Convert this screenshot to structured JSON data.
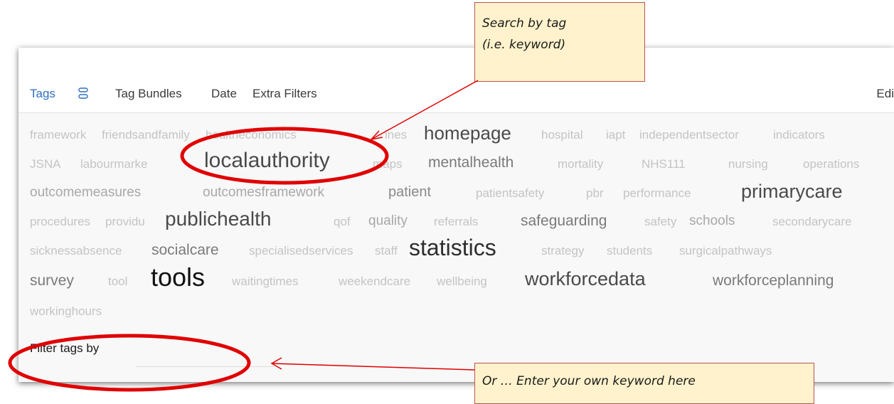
{
  "tabs": {
    "tags": "Tags",
    "tag_bundles": "Tag Bundles",
    "date": "Date",
    "extra_filters": "Extra Filters",
    "edit": "Edi"
  },
  "tag_cloud": [
    {
      "text": "framework",
      "size": "small"
    },
    {
      "text": "friendsandfamily",
      "size": "small"
    },
    {
      "text": "healtheconomics",
      "size": "small"
    },
    {
      "text": "ines",
      "size": "small"
    },
    {
      "text": "homepage",
      "size": "large"
    },
    {
      "text": "hospital",
      "size": "small"
    },
    {
      "text": "iapt",
      "size": "small"
    },
    {
      "text": "independentsector",
      "size": "small"
    },
    {
      "text": "indicators",
      "size": "small"
    },
    {
      "text": "JSNA",
      "size": "small"
    },
    {
      "text": "labourmarke",
      "size": "small"
    },
    {
      "text": "localauthority",
      "size": "xlarge"
    },
    {
      "text": "maps",
      "size": "small"
    },
    {
      "text": "mentalhealth",
      "size": "medium"
    },
    {
      "text": "mortality",
      "size": "small"
    },
    {
      "text": "NHS111",
      "size": "small"
    },
    {
      "text": "nursing",
      "size": "small"
    },
    {
      "text": "operations",
      "size": "small"
    },
    {
      "text": "outcomemeasures",
      "size": "small"
    },
    {
      "text": "outcomesframework",
      "size": "small"
    },
    {
      "text": "patient",
      "size": "small"
    },
    {
      "text": "patientsafety",
      "size": "small"
    },
    {
      "text": "pbr",
      "size": "small"
    },
    {
      "text": "performance",
      "size": "small"
    },
    {
      "text": "primarycare",
      "size": "large"
    },
    {
      "text": "procedures",
      "size": "small"
    },
    {
      "text": "providu",
      "size": "small"
    },
    {
      "text": "publichealth",
      "size": "large"
    },
    {
      "text": "qof",
      "size": "small"
    },
    {
      "text": "quality",
      "size": "small"
    },
    {
      "text": "referrals",
      "size": "small"
    },
    {
      "text": "safeguarding",
      "size": "medium"
    },
    {
      "text": "safety",
      "size": "small"
    },
    {
      "text": "schools",
      "size": "small"
    },
    {
      "text": "secondarycare",
      "size": "small"
    },
    {
      "text": "sicknessabsence",
      "size": "small"
    },
    {
      "text": "socialcare",
      "size": "medium"
    },
    {
      "text": "specialisedservices",
      "size": "small"
    },
    {
      "text": "staff",
      "size": "small"
    },
    {
      "text": "statistics",
      "size": "xlarge"
    },
    {
      "text": "strategy",
      "size": "small"
    },
    {
      "text": "students",
      "size": "small"
    },
    {
      "text": "surgicalpathways",
      "size": "small"
    },
    {
      "text": "survey",
      "size": "medium"
    },
    {
      "text": "tool",
      "size": "small"
    },
    {
      "text": "tools",
      "size": "xlarge"
    },
    {
      "text": "waitingtimes",
      "size": "small"
    },
    {
      "text": "weekendcare",
      "size": "small"
    },
    {
      "text": "wellbeing",
      "size": "small"
    },
    {
      "text": "workforcedata",
      "size": "large"
    },
    {
      "text": "workforceplanning",
      "size": "medium"
    },
    {
      "text": "workinghours",
      "size": "small"
    }
  ],
  "filter": {
    "label": "Filter tags by",
    "value": ""
  },
  "callouts": {
    "search_line1": "Search by tag",
    "search_line2": "(i.e. keyword)",
    "enter_keyword": "Or … Enter your own keyword here"
  },
  "colors": {
    "active_tab": "#2f6fbf",
    "callout_fill": "#fff2cc",
    "callout_border": "#b85450",
    "annotation_red": "#e00000"
  },
  "icons": {
    "tags_toggle": "stack-icon"
  }
}
